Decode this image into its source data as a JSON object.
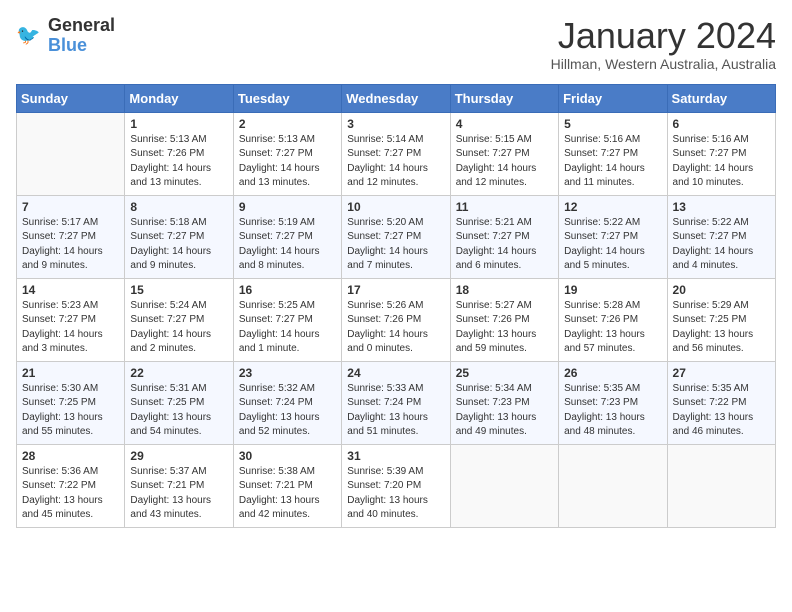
{
  "header": {
    "logo_line1": "General",
    "logo_line2": "Blue",
    "title": "January 2024",
    "subtitle": "Hillman, Western Australia, Australia"
  },
  "days_of_week": [
    "Sunday",
    "Monday",
    "Tuesday",
    "Wednesday",
    "Thursday",
    "Friday",
    "Saturday"
  ],
  "weeks": [
    [
      {
        "day": "",
        "info": ""
      },
      {
        "day": "1",
        "info": "Sunrise: 5:13 AM\nSunset: 7:26 PM\nDaylight: 14 hours\nand 13 minutes."
      },
      {
        "day": "2",
        "info": "Sunrise: 5:13 AM\nSunset: 7:27 PM\nDaylight: 14 hours\nand 13 minutes."
      },
      {
        "day": "3",
        "info": "Sunrise: 5:14 AM\nSunset: 7:27 PM\nDaylight: 14 hours\nand 12 minutes."
      },
      {
        "day": "4",
        "info": "Sunrise: 5:15 AM\nSunset: 7:27 PM\nDaylight: 14 hours\nand 12 minutes."
      },
      {
        "day": "5",
        "info": "Sunrise: 5:16 AM\nSunset: 7:27 PM\nDaylight: 14 hours\nand 11 minutes."
      },
      {
        "day": "6",
        "info": "Sunrise: 5:16 AM\nSunset: 7:27 PM\nDaylight: 14 hours\nand 10 minutes."
      }
    ],
    [
      {
        "day": "7",
        "info": "Sunrise: 5:17 AM\nSunset: 7:27 PM\nDaylight: 14 hours\nand 9 minutes."
      },
      {
        "day": "8",
        "info": "Sunrise: 5:18 AM\nSunset: 7:27 PM\nDaylight: 14 hours\nand 9 minutes."
      },
      {
        "day": "9",
        "info": "Sunrise: 5:19 AM\nSunset: 7:27 PM\nDaylight: 14 hours\nand 8 minutes."
      },
      {
        "day": "10",
        "info": "Sunrise: 5:20 AM\nSunset: 7:27 PM\nDaylight: 14 hours\nand 7 minutes."
      },
      {
        "day": "11",
        "info": "Sunrise: 5:21 AM\nSunset: 7:27 PM\nDaylight: 14 hours\nand 6 minutes."
      },
      {
        "day": "12",
        "info": "Sunrise: 5:22 AM\nSunset: 7:27 PM\nDaylight: 14 hours\nand 5 minutes."
      },
      {
        "day": "13",
        "info": "Sunrise: 5:22 AM\nSunset: 7:27 PM\nDaylight: 14 hours\nand 4 minutes."
      }
    ],
    [
      {
        "day": "14",
        "info": "Sunrise: 5:23 AM\nSunset: 7:27 PM\nDaylight: 14 hours\nand 3 minutes."
      },
      {
        "day": "15",
        "info": "Sunrise: 5:24 AM\nSunset: 7:27 PM\nDaylight: 14 hours\nand 2 minutes."
      },
      {
        "day": "16",
        "info": "Sunrise: 5:25 AM\nSunset: 7:27 PM\nDaylight: 14 hours\nand 1 minute."
      },
      {
        "day": "17",
        "info": "Sunrise: 5:26 AM\nSunset: 7:26 PM\nDaylight: 14 hours\nand 0 minutes."
      },
      {
        "day": "18",
        "info": "Sunrise: 5:27 AM\nSunset: 7:26 PM\nDaylight: 13 hours\nand 59 minutes."
      },
      {
        "day": "19",
        "info": "Sunrise: 5:28 AM\nSunset: 7:26 PM\nDaylight: 13 hours\nand 57 minutes."
      },
      {
        "day": "20",
        "info": "Sunrise: 5:29 AM\nSunset: 7:25 PM\nDaylight: 13 hours\nand 56 minutes."
      }
    ],
    [
      {
        "day": "21",
        "info": "Sunrise: 5:30 AM\nSunset: 7:25 PM\nDaylight: 13 hours\nand 55 minutes."
      },
      {
        "day": "22",
        "info": "Sunrise: 5:31 AM\nSunset: 7:25 PM\nDaylight: 13 hours\nand 54 minutes."
      },
      {
        "day": "23",
        "info": "Sunrise: 5:32 AM\nSunset: 7:24 PM\nDaylight: 13 hours\nand 52 minutes."
      },
      {
        "day": "24",
        "info": "Sunrise: 5:33 AM\nSunset: 7:24 PM\nDaylight: 13 hours\nand 51 minutes."
      },
      {
        "day": "25",
        "info": "Sunrise: 5:34 AM\nSunset: 7:23 PM\nDaylight: 13 hours\nand 49 minutes."
      },
      {
        "day": "26",
        "info": "Sunrise: 5:35 AM\nSunset: 7:23 PM\nDaylight: 13 hours\nand 48 minutes."
      },
      {
        "day": "27",
        "info": "Sunrise: 5:35 AM\nSunset: 7:22 PM\nDaylight: 13 hours\nand 46 minutes."
      }
    ],
    [
      {
        "day": "28",
        "info": "Sunrise: 5:36 AM\nSunset: 7:22 PM\nDaylight: 13 hours\nand 45 minutes."
      },
      {
        "day": "29",
        "info": "Sunrise: 5:37 AM\nSunset: 7:21 PM\nDaylight: 13 hours\nand 43 minutes."
      },
      {
        "day": "30",
        "info": "Sunrise: 5:38 AM\nSunset: 7:21 PM\nDaylight: 13 hours\nand 42 minutes."
      },
      {
        "day": "31",
        "info": "Sunrise: 5:39 AM\nSunset: 7:20 PM\nDaylight: 13 hours\nand 40 minutes."
      },
      {
        "day": "",
        "info": ""
      },
      {
        "day": "",
        "info": ""
      },
      {
        "day": "",
        "info": ""
      }
    ]
  ]
}
